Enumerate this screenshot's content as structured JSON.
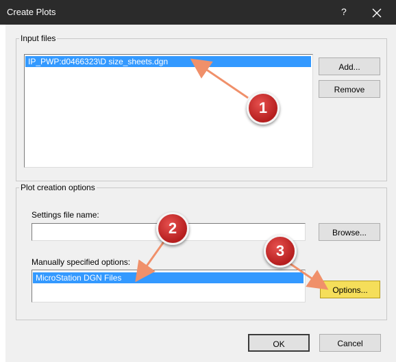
{
  "window": {
    "title": "Create Plots",
    "help_label": "?",
    "close_icon": "close-icon"
  },
  "input_files": {
    "group_label": "Input files",
    "items": [
      "IP_PWP:d0466323\\D size_sheets.dgn"
    ],
    "add_label": "Add...",
    "remove_label": "Remove"
  },
  "plot_options": {
    "group_label": "Plot creation options",
    "settings_label": "Settings file name:",
    "settings_value": "",
    "browse_label": "Browse...",
    "manual_label": "Manually specified options:",
    "manual_items": [
      "MicroStation DGN Files"
    ],
    "options_label": "Options..."
  },
  "footer": {
    "ok_label": "OK",
    "cancel_label": "Cancel"
  },
  "annotations": {
    "badges": [
      "1",
      "2",
      "3"
    ],
    "arrow_color": "#f0906a",
    "badge_color": "#c62828"
  },
  "colors": {
    "titlebar": "#2b2b2b",
    "selection": "#3399ff",
    "highlight_button": "#f5de5a"
  }
}
